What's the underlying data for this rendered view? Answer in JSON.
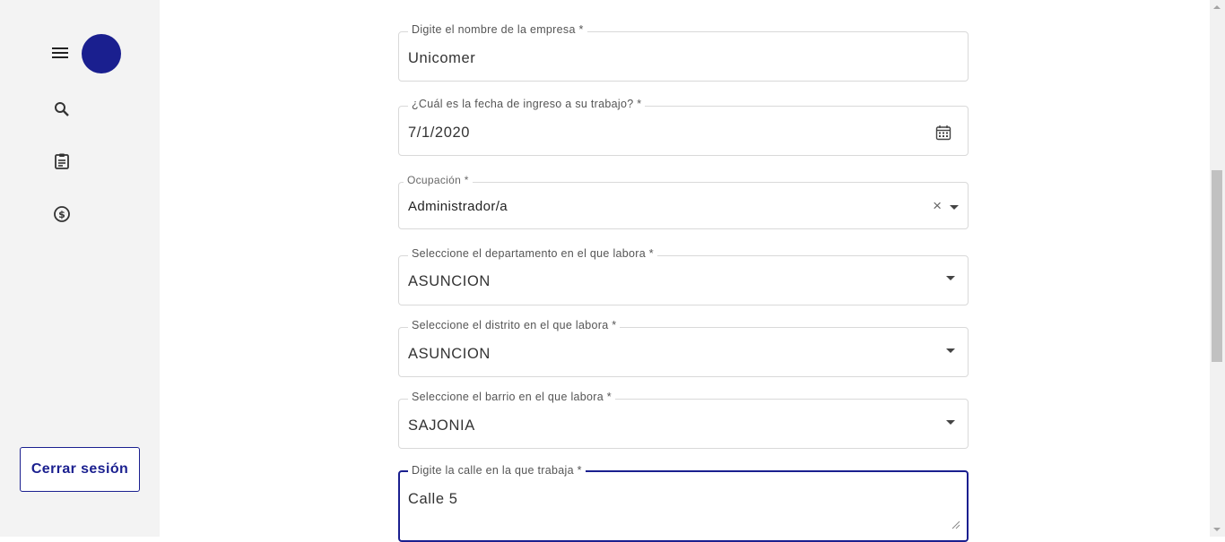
{
  "sidebar": {
    "logout_label": "Cerrar sesión"
  },
  "form": {
    "empresa": {
      "label": "Digite el nombre de la empresa *",
      "value": "Unicomer"
    },
    "fecha_ingreso": {
      "label": "¿Cuál es la fecha de ingreso a su trabajo? *",
      "value": "7/1/2020"
    },
    "ocupacion": {
      "label": "Ocupación *",
      "value": "Administrador/a",
      "clear_glyph": "×"
    },
    "departamento": {
      "label": "Seleccione el departamento en el que labora *",
      "value": "ASUNCION"
    },
    "distrito": {
      "label": "Seleccione el distrito en el que labora *",
      "value": "ASUNCION"
    },
    "barrio": {
      "label": "Seleccione el barrio en el que labora *",
      "value": "SAJONIA"
    },
    "calle": {
      "label": "Digite la calle en la que trabaja *",
      "value": "Calle 5"
    }
  },
  "colors": {
    "accent": "#1a1f8f",
    "sidebar_bg": "#f3f3f3",
    "border": "#d9d9d9"
  },
  "icons": [
    "menu-icon",
    "search-icon",
    "clipboard-icon",
    "dollar-icon",
    "calendar-icon",
    "clear-icon",
    "chevron-down-icon",
    "resize-handle-icon"
  ]
}
